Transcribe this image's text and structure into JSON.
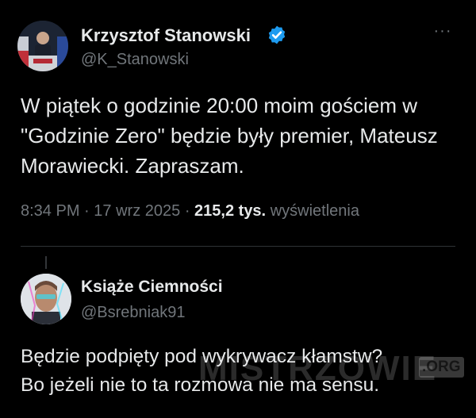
{
  "tweet": {
    "author": {
      "display_name": "Krzysztof Stanowski",
      "handle": "@K_Stanowski",
      "verified": true
    },
    "more_label": "···",
    "lines": [
      "W piątek o godzinie 20:00 moim gościem w",
      "\"Godzinie Zero\" będzie były premier, Mateusz",
      "Morawiecki. Zapraszam."
    ],
    "time": "8:34 PM",
    "separator": "·",
    "date": "17 wrz 2025",
    "views_count": "215,2 tys.",
    "views_label": "wyświetlenia"
  },
  "reply": {
    "author": {
      "display_name": "Książe Ciemności",
      "handle": "@Bsrebniak91"
    },
    "lines": [
      "Będzie podpięty pod wykrywacz kłamstw?",
      "Bo jeżeli nie to ta rozmowa nie ma sensu."
    ]
  },
  "watermark": {
    "main": "MISTRZOWIE",
    "suffix": ".ORG"
  },
  "colors": {
    "background": "#000000",
    "text_primary": "#e7e9ea",
    "text_secondary": "#71767b",
    "verified_blue": "#1d9bf0",
    "divider": "#2f3336"
  },
  "icons": {
    "verified": "verified-badge-icon",
    "more": "more-dots-icon"
  }
}
